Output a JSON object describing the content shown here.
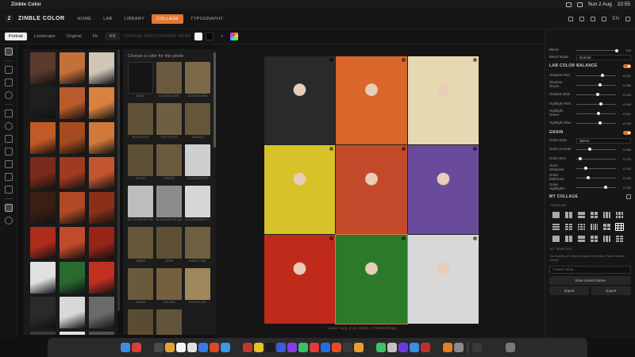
{
  "menubar": {
    "app": "Zinble Color",
    "right": [
      "Sun 2 Aug",
      "22:55"
    ]
  },
  "header": {
    "logo": "Z",
    "brand": "ZINBLE COLOR",
    "tabs": [
      {
        "label": "HOME",
        "active": false
      },
      {
        "label": "LAB",
        "active": false
      },
      {
        "label": "LIBRARY",
        "active": false
      },
      {
        "label": "COLLAGE",
        "active": true
      },
      {
        "label": "TYPOGRAPHY",
        "active": false
      }
    ],
    "lang": "EN"
  },
  "toolbar": {
    "orientation": [
      "Portrait",
      "Landscape",
      "Original"
    ],
    "fit_label": "Fit",
    "ratio": "4:5",
    "faint": "CHOOSE BACKGROUND HERE"
  },
  "photo_colors": [
    "#5a3b2d",
    "#c4703a",
    "#cfc6b8",
    "#1e1e1e",
    "#b85a2c",
    "#d98240",
    "#c25a28",
    "#a64a20",
    "#d07a3a",
    "#7a2a1a",
    "#a03a20",
    "#c05530",
    "#3a1e14",
    "#b04a24",
    "#8a3018",
    "#ac2c1a",
    "#c24a2a",
    "#982418",
    "#e0e0e0",
    "#2a6a30",
    "#c03020",
    "#2a2a2a",
    "#d8d8d8",
    "#6a6a6a",
    "#3a3a3a",
    "#e0e0e0",
    "#505050"
  ],
  "color_panel": {
    "title": "Choose a color for this photo",
    "presets": [
      {
        "label": "NONE",
        "color": "#151515"
      },
      {
        "label": "CLASSIC DARK",
        "color": "#6a5a40"
      },
      {
        "label": "KODAK WARM",
        "color": "#7a6848"
      },
      {
        "label": "BLUE HOUR",
        "color": "#605238"
      },
      {
        "label": "FILM STOCK",
        "color": "#6e5e42"
      },
      {
        "label": "VINTAGE",
        "color": "#665538"
      },
      {
        "label": "RETRO",
        "color": "#5e5036"
      },
      {
        "label": "CINEMA",
        "color": "#6a5a3e"
      },
      {
        "label": "BLACK&WHITE",
        "color": "#cfcfcf"
      },
      {
        "label": "BLACK&WHITE FADE",
        "color": "#bdbdbd"
      },
      {
        "label": "BLACK&WHITE NOIR",
        "color": "#8c8c8c"
      },
      {
        "label": "BLACK&WHITE+++",
        "color": "#d6d6d6"
      },
      {
        "label": "AMBER",
        "color": "#66563a"
      },
      {
        "label": "SEPIA",
        "color": "#5e5034"
      },
      {
        "label": "WARM TONE",
        "color": "#706042"
      },
      {
        "label": "CREAM",
        "color": "#6a5a3c"
      },
      {
        "label": "GOLDEN",
        "color": "#74603c"
      },
      {
        "label": "PORTRA 400",
        "color": "#a0885c"
      },
      {
        "label": "DUSK",
        "color": "#5a4c34"
      },
      {
        "label": "FADE",
        "color": "#62543a"
      }
    ]
  },
  "collage": {
    "cells": [
      "#2a2a2a",
      "#d9662a",
      "#e6d8b0",
      "#d8c22a",
      "#c24a2a",
      "#6a4a9a",
      "#c02a1a",
      "#2a7a2a",
      "#d8d8d8"
    ],
    "status": "Saved: Yang_final_collage_1760848459.jpg"
  },
  "right_panel": {
    "blend": {
      "label": "Blend",
      "value": "100",
      "level": 0.98
    },
    "blend_mode": {
      "label": "Blend Mode",
      "value": "Normal"
    },
    "lab_section": "LAB COLOR BALANCE",
    "lab_sliders": [
      {
        "label": "Shadow Red",
        "value": "-0.341",
        "level": 0.62
      },
      {
        "label": "Shadow Green",
        "value": "-0.089",
        "level": 0.55
      },
      {
        "label": "Shadow Blue",
        "value": "-0.140",
        "level": 0.5
      },
      {
        "label": "Highlight Red",
        "value": "-0.349",
        "level": 0.58
      },
      {
        "label": "Highlight Green",
        "value": "-0.401",
        "level": 0.52
      },
      {
        "label": "Highlight Blue",
        "value": "-0.033",
        "level": 0.56
      }
    ],
    "grain_section": "GRAIN",
    "grain_style": {
      "label": "Grain Style",
      "value": "35mm"
    },
    "grain_sliders": [
      {
        "label": "Grain Amount",
        "value": "0.580",
        "level": 0.3
      },
      {
        "label": "Grain Size",
        "value": "0.075",
        "level": 0.05
      },
      {
        "label": "Grain Shadows",
        "value": "0.200",
        "level": 0.2
      },
      {
        "label": "Grain Midtones",
        "value": "0.240",
        "level": 0.25
      },
      {
        "label": "Grain Highlights",
        "value": "0.760",
        "level": 0.7
      }
    ],
    "collage_section": "MY COLLAGE",
    "template_label": "TEMPLATE",
    "my_template_label": "MY TEMPLATE",
    "note": "No frames yet. Build a layout then click \"Save current frame\"",
    "input_placeholder": "Frame name...",
    "save_button": "Save current frame",
    "import_button": "Import",
    "export_button": "Export"
  },
  "dock_colors": [
    "#3a8ee6",
    "#e03a3a",
    "#2a2a2a",
    "#4a4a4a",
    "#e5a232",
    "#f5f5f5",
    "#e0e0e0",
    "#3a7ae6",
    "#d84a2a",
    "#3a9ae6",
    "#2a2a2a",
    "#c03a2a",
    "#e6c22a",
    "#1a1a1a",
    "#3a5ae6",
    "#8a3ae6",
    "#3ac26a",
    "#e63a3a",
    "#2a6ae6",
    "#ea4a2a",
    "#3a3a3a",
    "#e6a02a",
    "#2a2a2a",
    "#3ac26a",
    "#c2c2c2",
    "#6a3ae6",
    "#3a8ee6",
    "#c03030",
    "#2a2a2a",
    "#e67e22",
    "#8a8a8a",
    "#3a3a3a",
    "#2a2a2a",
    "#2a2a2a",
    "#777777"
  ]
}
